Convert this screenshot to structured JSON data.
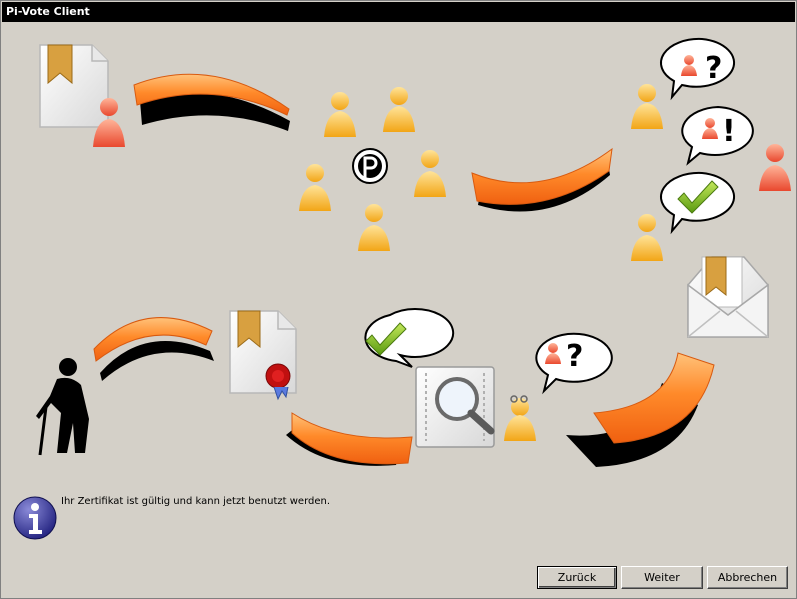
{
  "window": {
    "title": "Pi-Vote Client"
  },
  "status": {
    "message": "Ihr Zertifikat ist gültig und kann jetzt benutzt werden."
  },
  "buttons": {
    "back": {
      "label": "Zurück"
    },
    "next": {
      "label": "Weiter"
    },
    "cancel": {
      "label": "Abbrechen"
    }
  },
  "bubbles": {
    "question": "?",
    "exclamation": "!"
  },
  "colors": {
    "titlebar": "#000000",
    "face": "#d4d0c8",
    "arrow": "#ff7f1e",
    "voter_yellow": "#f6b93b",
    "voter_red": "#f06a4a",
    "check_green": "#7cb518"
  },
  "icons": [
    "certificate-icon",
    "voter-icon",
    "pirate-logo-icon",
    "speech-bubble-icon",
    "checkmark-icon",
    "envelope-icon",
    "elderly-person-icon",
    "sealed-certificate-icon",
    "magnifier-document-icon",
    "info-icon"
  ]
}
